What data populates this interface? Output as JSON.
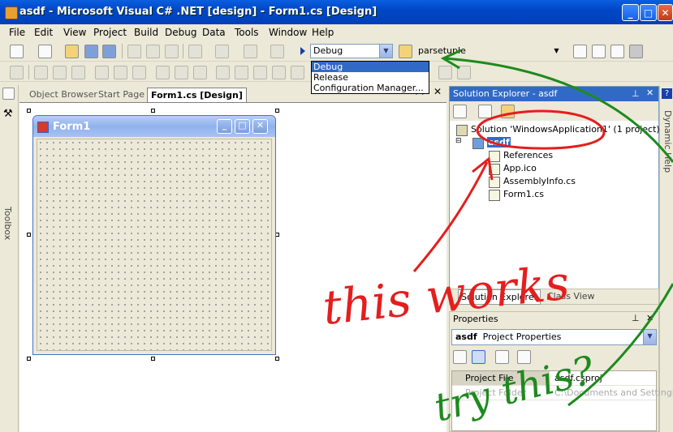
{
  "window": {
    "title": "asdf - Microsoft Visual C# .NET [design] - Form1.cs [Design]",
    "min": "_",
    "max": "□",
    "close": "✕"
  },
  "menu": [
    "File",
    "Edit",
    "View",
    "Project",
    "Build",
    "Debug",
    "Data",
    "Tools",
    "Window",
    "Help"
  ],
  "toolbar": {
    "config_value": "Debug",
    "find_value": "parsetuple",
    "config_options": [
      "Debug",
      "Release",
      "Configuration Manager..."
    ],
    "selected_option": "Debug"
  },
  "toolbox": {
    "label": "Toolbox"
  },
  "tabs": [
    {
      "label": "Object Browser",
      "active": false
    },
    {
      "label": "Start Page",
      "active": false
    },
    {
      "label": "Form1.cs [Design]",
      "active": true
    }
  ],
  "form": {
    "title": "Form1"
  },
  "solution_explorer": {
    "title": "Solution Explorer - asdf",
    "solution": "Solution 'WindowsApplication1' (1 project)",
    "project": "asdf",
    "items": [
      "References",
      "App.ico",
      "AssemblyInfo.cs",
      "Form1.cs"
    ],
    "tabs": [
      "Solution Explorer",
      "Class View"
    ]
  },
  "dynamic_help": {
    "label": "Dynamic Help"
  },
  "properties": {
    "title": "Properties",
    "object_name": "asdf",
    "object_type": "Project Properties",
    "rows": [
      {
        "name": "Project File",
        "value": "asdf.csproj"
      },
      {
        "name": "Project Folder",
        "value": "C:\\Documents and Settings"
      }
    ]
  },
  "annotations": {
    "red_text": "this works",
    "green_text": "try this?",
    "red_color": "#e41e1e",
    "green_color": "#1e8a1e"
  }
}
